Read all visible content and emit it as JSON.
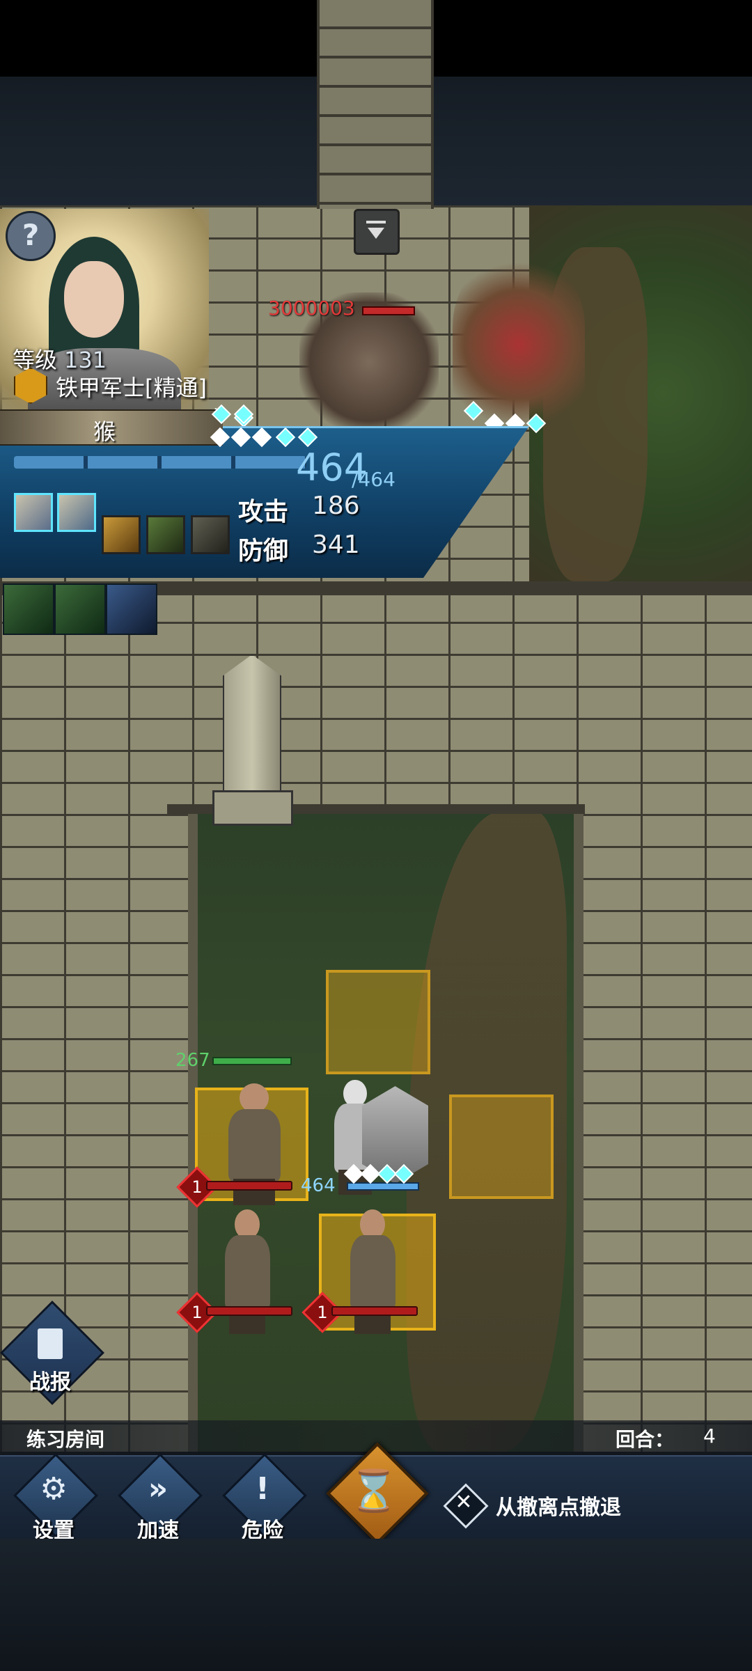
{
  "board": {
    "enemy_hp_text": "3000003",
    "obelisk_hp": "267",
    "knight_hp": "464"
  },
  "unit_panel": {
    "help_icon": "?",
    "level_label": "等级",
    "level_value": "131",
    "class_name": "铁甲军士[精通]",
    "unit_name": "猴",
    "hp_current": "464",
    "hp_max": "/464",
    "attack_label": "攻击",
    "attack_value": "186",
    "defense_label": "防御",
    "defense_value": "341"
  },
  "enemy_units": [
    {
      "hp_badge": "1"
    },
    {
      "hp_badge": "1"
    },
    {
      "hp_badge": "1"
    }
  ],
  "hud": {
    "battle_report_label": "战报",
    "room_name": "练习房间",
    "round_label": "回合：",
    "round_value": "4",
    "settings_label": "设置",
    "speed_label": "加速",
    "danger_label": "危险",
    "retreat_label": "从撤离点撤退"
  },
  "colors": {
    "panel_blue": "#103e63",
    "tile_highlight": "#e8b31a",
    "enemy_red": "#e23a3a",
    "ally_green": "#5fd16b",
    "end_turn_orange": "#d8922e"
  }
}
